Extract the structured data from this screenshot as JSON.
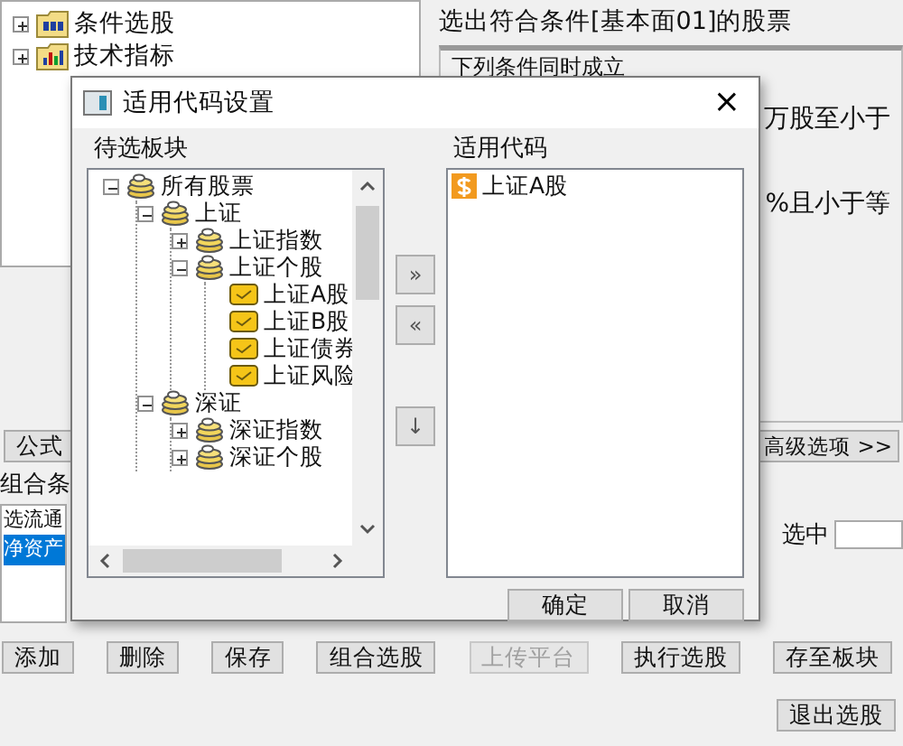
{
  "main_window": {
    "formula_tree": [
      {
        "label": "条件选股",
        "expanded": false
      },
      {
        "label": "技术指标",
        "expanded": false
      }
    ],
    "result_title": "选出符合条件[基本面01]的股票",
    "condition_group": {
      "title": "下列条件同时成立",
      "lines": [
        "万股至小于",
        "%且小于等"
      ]
    },
    "formula_button": "公式",
    "advanced_button": "高级选项 >>",
    "combo_label": "组合条",
    "condition_list": [
      {
        "label": "选流通",
        "selected": false
      },
      {
        "label": "净资产",
        "selected": true
      }
    ],
    "selected_label": "选中",
    "buttons": [
      {
        "label": "添加",
        "disabled": false
      },
      {
        "label": "删除",
        "disabled": false
      },
      {
        "label": "保存",
        "disabled": false
      },
      {
        "label": "组合选股",
        "disabled": false
      },
      {
        "label": "上传平台",
        "disabled": true
      },
      {
        "label": "执行选股",
        "disabled": false
      },
      {
        "label": "存至板块",
        "disabled": false
      }
    ],
    "exit_button": "退出选股"
  },
  "dialog": {
    "title": "适用代码设置",
    "close_button": "×",
    "candidate_group": {
      "title": "待选板块",
      "tree": [
        {
          "label": "所有股票",
          "expanded": true,
          "children": [
            {
              "label": "上证",
              "expanded": true,
              "children": [
                {
                  "label": "上证指数",
                  "expanded": false
                },
                {
                  "label": "上证个股",
                  "expanded": true,
                  "children": [
                    {
                      "label": "上证A股"
                    },
                    {
                      "label": "上证B股"
                    },
                    {
                      "label": "上证债券"
                    },
                    {
                      "label": "上证风险"
                    }
                  ]
                }
              ]
            },
            {
              "label": "深证",
              "expanded": true,
              "children": [
                {
                  "label": "深证指数",
                  "expanded": false
                },
                {
                  "label": "深证个股",
                  "expanded": false
                }
              ]
            }
          ]
        }
      ]
    },
    "move_buttons": [
      "»",
      "«",
      "↓"
    ],
    "applicable_group": {
      "title": "适用代码",
      "items": [
        "上证A股"
      ]
    },
    "ok_button": "确定",
    "cancel_button": "取消"
  }
}
